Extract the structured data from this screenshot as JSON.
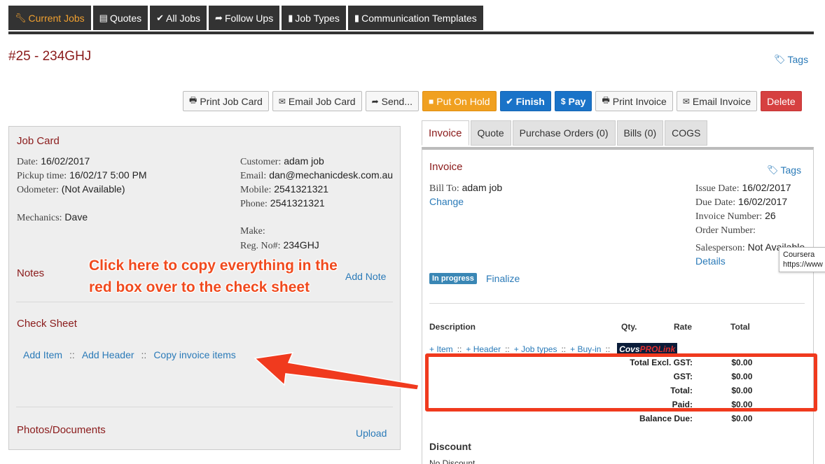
{
  "nav": {
    "tabs": [
      {
        "label": "Current Jobs",
        "icon": "wrench-icon"
      },
      {
        "label": "Quotes",
        "icon": "document-icon"
      },
      {
        "label": "All Jobs",
        "icon": "check-icon"
      },
      {
        "label": "Follow Ups",
        "icon": "share-icon"
      },
      {
        "label": "Job Types",
        "icon": "file-icon"
      },
      {
        "label": "Communication Templates",
        "icon": "file-icon"
      }
    ]
  },
  "job": {
    "title": "#25 - 234GHJ",
    "tags_label": "Tags"
  },
  "actions": {
    "print_job_card": "Print Job Card",
    "email_job_card": "Email Job Card",
    "send": "Send...",
    "put_on_hold": "Put On Hold",
    "finish": "Finish",
    "pay": "Pay",
    "print_invoice": "Print Invoice",
    "email_invoice": "Email Invoice",
    "delete": "Delete"
  },
  "job_card": {
    "title": "Job Card",
    "date_label": "Date:",
    "date": "16/02/2017",
    "pickup_label": "Pickup time:",
    "pickup": "16/02/17 5:00 PM",
    "odometer_label": "Odometer:",
    "odometer": "(Not Available)",
    "mechanics_label": "Mechanics:",
    "mechanics": "Dave",
    "customer_label": "Customer:",
    "customer": "adam job",
    "email_label": "Email:",
    "email": "dan@mechanicdesk.com.au",
    "mobile_label": "Mobile:",
    "mobile": "2541321321",
    "phone_label": "Phone:",
    "phone": "2541321321",
    "make_label": "Make:",
    "make": "",
    "reg_label": "Reg. No#:",
    "reg": "234GHJ",
    "notes_title": "Notes",
    "add_note": "Add Note",
    "check_sheet_title": "Check Sheet",
    "add_item": "Add Item",
    "add_header": "Add Header",
    "copy_invoice_items": "Copy invoice items",
    "separator": "::",
    "photos_title": "Photos/Documents",
    "upload": "Upload"
  },
  "right_tabs": [
    "Invoice",
    "Quote",
    "Purchase Orders (0)",
    "Bills (0)",
    "COGS"
  ],
  "invoice": {
    "title": "Invoice",
    "tags_label": "Tags",
    "bill_to_label": "Bill To:",
    "bill_to": "adam job",
    "change": "Change",
    "issue_date_label": "Issue Date:",
    "issue_date": "16/02/2017",
    "due_date_label": "Due Date:",
    "due_date": "16/02/2017",
    "invoice_number_label": "Invoice Number:",
    "invoice_number": "26",
    "order_number_label": "Order Number:",
    "order_number": "",
    "salesperson_label": "Salesperson:",
    "salesperson": "Not Available",
    "details": "Details",
    "status": "In progress",
    "finalize": "Finalize",
    "col_description": "Description",
    "col_qty": "Qty.",
    "col_rate": "Rate",
    "col_total": "Total",
    "add_links": [
      "+ Item",
      "+ Header",
      "+ Job types",
      "+ Buy-in"
    ],
    "separator": "::",
    "logo_part1": "Covs",
    "logo_part2": "PROLink",
    "totals": [
      {
        "label": "Total Excl. GST:",
        "value": "$0.00"
      },
      {
        "label": "GST:",
        "value": "$0.00"
      },
      {
        "label": "Total:",
        "value": "$0.00"
      },
      {
        "label": "Paid:",
        "value": "$0.00"
      },
      {
        "label": "Balance Due:",
        "value": "$0.00"
      }
    ],
    "discount_title": "Discount",
    "discount_value": "No Discount"
  },
  "tooltip": {
    "line1": "Coursera",
    "line2": "https://www"
  },
  "annotation": {
    "line1": "Click here to copy everything in the",
    "line2": "red box over to the check sheet"
  },
  "colors": {
    "annotation": "#f04a1e",
    "nav_active": "#f0a030",
    "brand_red": "#8a1a1a",
    "link": "#2a7ab8"
  }
}
